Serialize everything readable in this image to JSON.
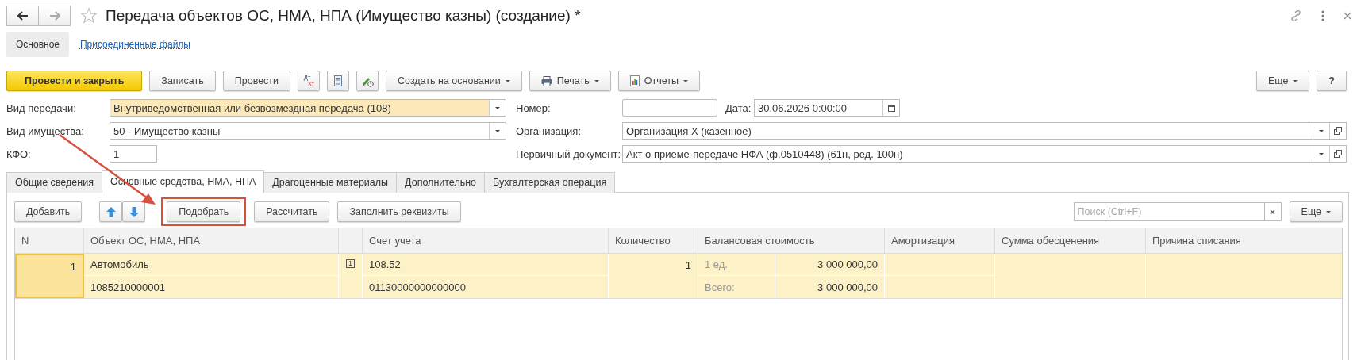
{
  "window": {
    "title": "Передача объектов ОС, НМА, НПА (Имущество казны) (создание) *"
  },
  "sections": [
    {
      "label": "Основное",
      "selected": true
    },
    {
      "label": "Присоединенные файлы",
      "selected": false
    }
  ],
  "toolbar": [
    {
      "kind": "primary",
      "label": "Провести и закрыть"
    },
    {
      "kind": "button",
      "label": "Записать"
    },
    {
      "kind": "button",
      "label": "Провести"
    },
    {
      "kind": "dtkt",
      "top": "Дт",
      "bottom": "Кт"
    },
    {
      "kind": "list"
    },
    {
      "kind": "edit"
    },
    {
      "kind": "menu",
      "label": "Создать на основании"
    },
    {
      "kind": "print",
      "label": "Печать"
    },
    {
      "kind": "report",
      "label": "Отчеты"
    }
  ],
  "toolbar_right": {
    "more": "Еще",
    "help": "?"
  },
  "fields": [
    {
      "label": "Вид передачи:",
      "value": "Внутриведомственная или безвозмездная передача (108)",
      "kind": "select",
      "focused": true
    },
    {
      "label": "Вид имущества:",
      "value": "50 - Имущество казны",
      "kind": "select",
      "focused": false
    },
    {
      "label": "КФО:",
      "value": "1",
      "kind": "short",
      "focused": false
    }
  ],
  "number": {
    "label": "Номер:"
  },
  "date": {
    "label": "Дата:",
    "value": "30.06.2026  0:00:00"
  },
  "organization": {
    "label": "Организация:",
    "value": "Организация Х (казенное)"
  },
  "primary_document": {
    "label": "Первичный документ:",
    "value": "Акт о приеме-передаче НФА (ф.0510448) (61н, ред. 100н)"
  },
  "tabs": [
    {
      "label": "Общие сведения",
      "selected": false
    },
    {
      "label": "Основные средства, НМА, НПА",
      "selected": true
    },
    {
      "label": "Драгоценные материалы",
      "selected": false
    },
    {
      "label": "Дополнительно",
      "selected": false
    },
    {
      "label": "Бухгалтерская операция",
      "selected": false
    }
  ],
  "table_toolbar": {
    "add": "Добавить",
    "pick": "Подобрать",
    "calculate": "Рассчитать",
    "fill": "Заполнить реквизиты",
    "search": {
      "placeholder": "Поиск (Ctrl+F)"
    },
    "more": "Еще"
  },
  "table": {
    "columns": [
      "N",
      "Объект ОС, НМА, НПА",
      "Счет учета",
      "Количество",
      "Балансовая стоимость",
      "Амортизация",
      "Сумма обесценения",
      "Причина списания"
    ],
    "rows": [
      {
        "n": "1",
        "object": "Автомобиль",
        "inventory_number": "1085210000001",
        "flag": "1",
        "account": "108.52",
        "kbk": "01130000000000000",
        "quantity": "1",
        "unit_label": "1 ед.",
        "unit_value": "3 000 000,00",
        "total_label": "Всего:",
        "total_value": "3 000 000,00",
        "selected": true,
        "focused": true
      }
    ]
  }
}
